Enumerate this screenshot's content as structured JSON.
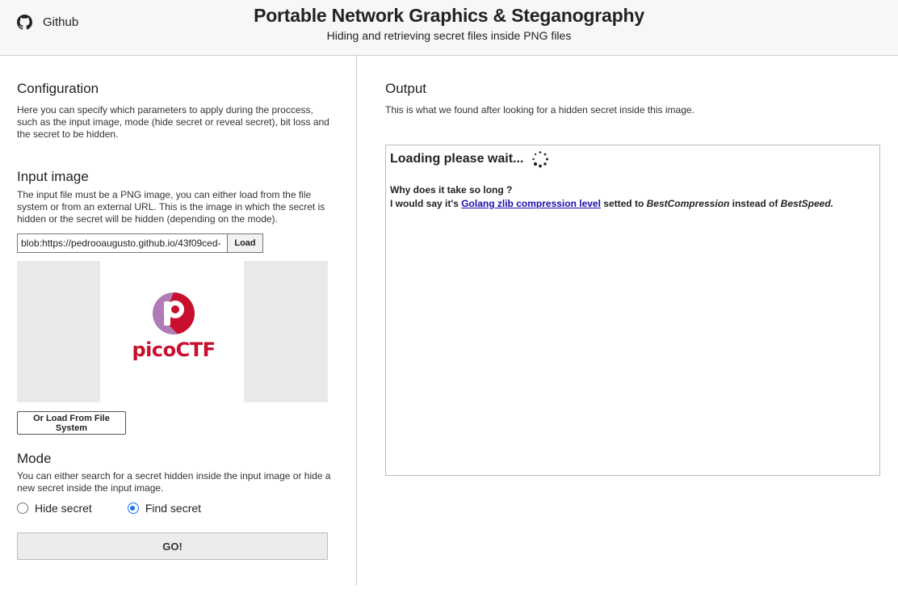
{
  "header": {
    "github_label": "Github",
    "title": "Portable Network Graphics & Steganography",
    "subtitle": "Hiding and retrieving secret files inside PNG files"
  },
  "config": {
    "title": "Configuration",
    "description": "Here you can specify which parameters to apply during the proccess, such as the input image, mode (hide secret or reveal secret), bit loss and the secret to be hidden."
  },
  "input_image": {
    "title": "Input image",
    "description": "The input file must be a PNG image, you can either load from the file system or from an external URL. This is the image in which the secret is hidden or the secret will be hidden (depending on the mode).",
    "url_value": "blob:https://pedrooaugusto.github.io/43f09ced-",
    "load_label": "Load",
    "preview_logo_text": "picoCTF",
    "file_button_label": "Or Load From File System"
  },
  "mode": {
    "title": "Mode",
    "description": "You can either search for a secret hidden inside the input image or hide a new secret inside the input image.",
    "options": [
      {
        "label": "Hide secret",
        "selected": false
      },
      {
        "label": "Find secret",
        "selected": true
      }
    ],
    "go_label": "GO!"
  },
  "output": {
    "title": "Output",
    "description": "This is what we found after looking for a hidden secret inside this image.",
    "loading_text": "Loading please wait...",
    "why_text": "Why does it take so long ?",
    "answer_prefix": "I would say it's ",
    "answer_link": "Golang zlib compression level",
    "answer_mid": " setted to ",
    "answer_em1": "BestCompression",
    "answer_mid2": " instead of ",
    "answer_em2": "BestSpeed."
  },
  "colors": {
    "accent": "#1a73e8",
    "link": "#1a0dab",
    "pico_red": "#c8102e",
    "pico_purple": "#b07bb6"
  }
}
